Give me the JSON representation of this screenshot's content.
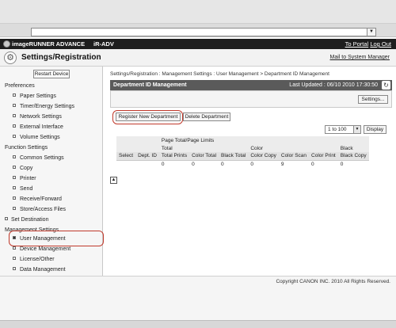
{
  "app": {
    "brand": "imageRUNNER ADVANCE",
    "model": "iR-ADV",
    "portal_link": "To Portal",
    "logout_link": "Log Out",
    "title": "Settings/Registration",
    "mail_link": "Mail to System Manager"
  },
  "sidebar": {
    "restart_button": "Restart Device",
    "preferences_heading": "Preferences",
    "preferences": [
      "Paper Settings",
      "Timer/Energy Settings",
      "Network Settings",
      "External Interface",
      "Volume Settings"
    ],
    "function_heading": "Function Settings",
    "functions": [
      "Common Settings",
      "Copy",
      "Printer",
      "Send",
      "Receive/Forward",
      "Store/Access Files"
    ],
    "set_destination": "Set Destination",
    "management_heading": "Management Settings",
    "management": [
      "User Management",
      "Device Management",
      "License/Other",
      "Data Management"
    ]
  },
  "main": {
    "breadcrumb": "Settings/Registration : Management Settings : User Management > Department ID Management",
    "panel_title": "Department ID Management",
    "last_updated": "Last Updated : 06/10 2010 17:30:50",
    "settings_button": "Settings...",
    "register_button": "Register New Department",
    "delete_button": "Delete Department",
    "range_select": "1 to 100",
    "display_button": "Display"
  },
  "table": {
    "group_header": "Page Total/Page Limits",
    "sub_total": "Total",
    "sub_color": "Color",
    "sub_black": "Black",
    "columns": [
      "Select",
      "Dept. ID",
      "Total Prints",
      "Color Total",
      "Black Total",
      "Color Copy",
      "Color Scan",
      "Color Print",
      "Black Copy"
    ],
    "row": [
      "",
      "",
      "0",
      "0",
      "0",
      "0",
      "9",
      "0",
      "0"
    ]
  },
  "footer": {
    "copyright": "Copyright CANON INC. 2010 All Rights Reserved."
  }
}
